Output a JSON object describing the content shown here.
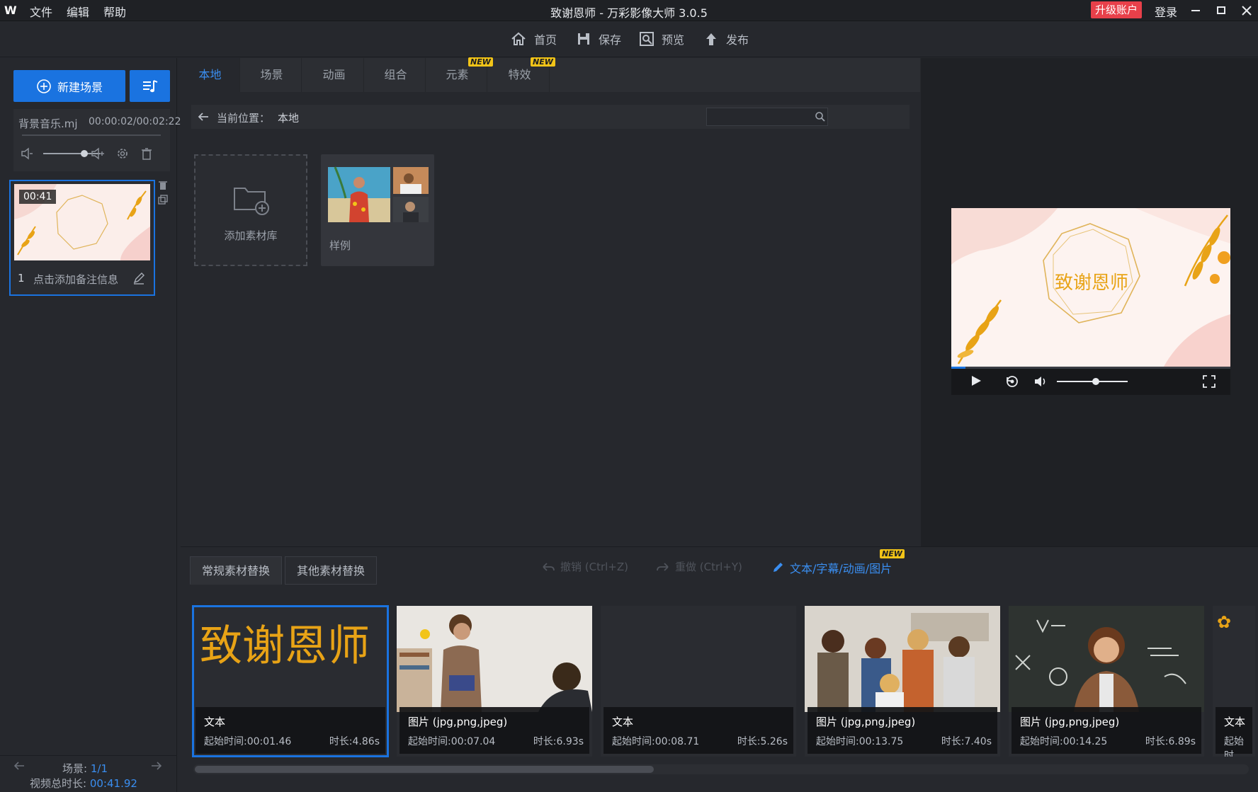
{
  "titlebar": {
    "menus": [
      "文件",
      "编辑",
      "帮助"
    ],
    "title": "致谢恩师 - 万彩影像大师 3.0.5",
    "upgrade": "升级账户",
    "login": "登录"
  },
  "toolbar": {
    "home": "首页",
    "save": "保存",
    "preview": "预览",
    "publish": "发布"
  },
  "left": {
    "new_scene": "新建场景",
    "bgm_name": "背景音乐.mj",
    "bgm_time": "00:00:02/00:02:22",
    "scene": {
      "duration": "00:41",
      "index": "1",
      "note": "点击添加备注信息"
    },
    "footer": {
      "scene_label": "场景:",
      "scene_count": "1/1",
      "total_label": "视频总时长:",
      "total_value": "00:41.92"
    }
  },
  "library": {
    "tabs": [
      "本地",
      "场景",
      "动画",
      "组合",
      "元素",
      "特效"
    ],
    "new_badge": "NEW",
    "breadcrumb_label": "当前位置：",
    "breadcrumb_value": "本地",
    "add_library": "添加素材库",
    "sample": "样例"
  },
  "preview": {
    "card_text": "致谢恩师",
    "volume": 0.55,
    "progress": 0.05
  },
  "bottom": {
    "tab_regular": "常规素材替换",
    "tab_other": "其他素材替换",
    "undo": "撤销 (Ctrl+Z)",
    "redo": "重做 (Ctrl+Y)",
    "edit_link": "文本/字幕/动画/图片",
    "cards": [
      {
        "kind": "text",
        "big_text": "致谢恩师",
        "type": "文本",
        "start": "起始时间:00:01.46",
        "duration": "时长:4.86s"
      },
      {
        "kind": "image",
        "type": "图片 (jpg,png,jpeg)",
        "start": "起始时间:00:07.04",
        "duration": "时长:6.93s"
      },
      {
        "kind": "text",
        "big_text": "",
        "type": "文本",
        "start": "起始时间:00:08.71",
        "duration": "时长:5.26s"
      },
      {
        "kind": "image",
        "type": "图片 (jpg,png,jpeg)",
        "start": "起始时间:00:13.75",
        "duration": "时长:7.40s"
      },
      {
        "kind": "image",
        "type": "图片 (jpg,png,jpeg)",
        "start": "起始时间:00:14.25",
        "duration": "时长:6.89s"
      },
      {
        "kind": "text",
        "type": "文本",
        "start": "起始时"
      }
    ]
  },
  "colors": {
    "accent": "#1a73e0",
    "gold": "#e8a316",
    "danger": "#e8404a",
    "new_badge": "#f2c418"
  }
}
